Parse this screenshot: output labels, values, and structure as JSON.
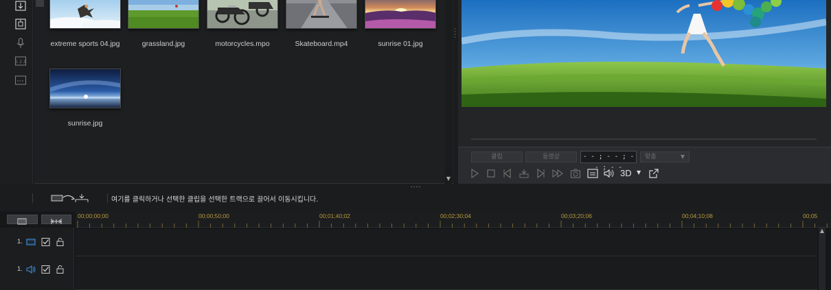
{
  "media_library": {
    "items": [
      {
        "name": "extreme sports 04.jpg"
      },
      {
        "name": "grassland.jpg"
      },
      {
        "name": "motorcycles.mpo"
      },
      {
        "name": "Skateboard.mp4"
      },
      {
        "name": "sunrise 01.jpg"
      },
      {
        "name": "sunrise.jpg"
      }
    ]
  },
  "preview": {
    "tab_clip": "클립",
    "tab_movie": "동영상",
    "timecode": "- - ; - - ; - - ; - -",
    "fit_select": "맞춤",
    "btn_3d": "3D"
  },
  "instruction": {
    "text": "여기를 클릭하거나 선택한 클립을 선택한 트랙으로 끌어서 이동시킵니다."
  },
  "timeline": {
    "timecodes": [
      "00;00;00;00",
      "00;00;50;00",
      "00;01;40;02",
      "00;02;30;04",
      "00;03;20;06",
      "00;04;10;08",
      "00;05"
    ],
    "tracks": [
      {
        "label": "1."
      },
      {
        "label": "1."
      }
    ]
  },
  "colors": {
    "accent_timecode": "#b89a3a",
    "track_video_icon": "#3c8bd6"
  }
}
